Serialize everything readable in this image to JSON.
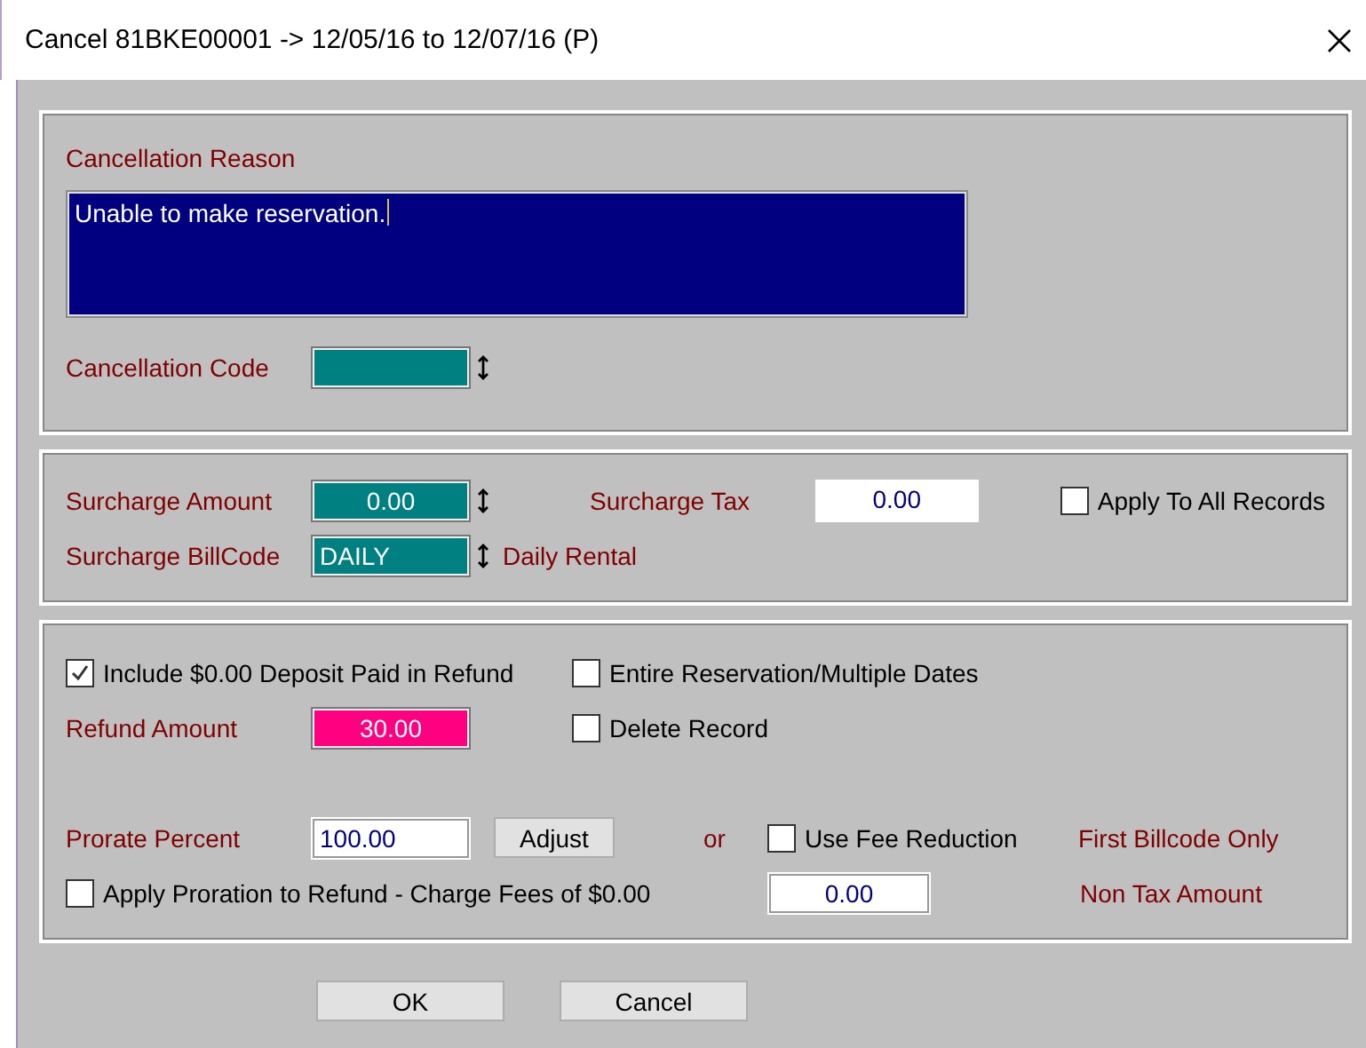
{
  "window": {
    "title": "Cancel 81BKE00001 -> 12/05/16 to 12/07/16 (P)"
  },
  "reason": {
    "label": "Cancellation Reason",
    "value": "Unable to make reservation."
  },
  "code": {
    "label": "Cancellation Code"
  },
  "surcharge": {
    "amount_label": "Surcharge Amount",
    "amount": "0.00",
    "tax_label": "Surcharge Tax",
    "tax": "0.00",
    "apply_all": {
      "label": "Apply To All Records",
      "checked": false
    },
    "billcode_label": "Surcharge BillCode",
    "billcode": "DAILY",
    "billcode_desc": "Daily Rental"
  },
  "refund": {
    "include_deposit": {
      "label": "Include $0.00 Deposit Paid in Refund",
      "checked": true
    },
    "entire": {
      "label": "Entire Reservation/Multiple Dates",
      "checked": false
    },
    "amount_label": "Refund Amount",
    "amount": "30.00",
    "delete": {
      "label": "Delete Record",
      "checked": false
    },
    "prorate_label": "Prorate Percent",
    "prorate": "100.00",
    "adjust": "Adjust",
    "or": "or",
    "fee_reduction": {
      "label": "Use Fee Reduction",
      "checked": false
    },
    "first_billcode": "First Billcode Only",
    "apply_proration": {
      "label": "Apply Proration to Refund - Charge Fees of $0.00",
      "checked": false
    },
    "non_tax": "0.00",
    "non_tax_label": "Non Tax Amount"
  },
  "buttons": [
    "OK",
    "Cancel"
  ]
}
